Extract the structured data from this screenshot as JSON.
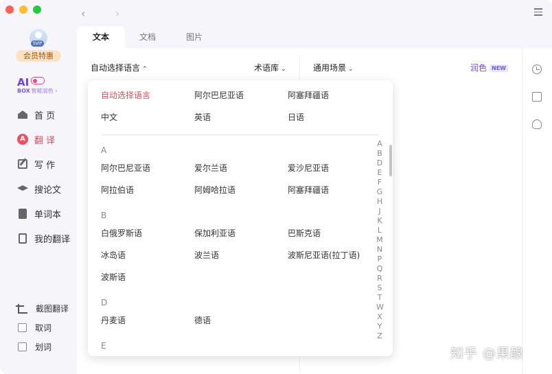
{
  "sidebar": {
    "avatar_badge": "SVIP",
    "member_label": "会员特惠",
    "aibox": {
      "ai": "AI",
      "box": "BOX",
      "sub": "智能润色 ›"
    },
    "nav": [
      {
        "label": "首 页",
        "icon": "home-icon"
      },
      {
        "label": "翻 译",
        "icon": "translate-icon",
        "active": true
      },
      {
        "label": "写 作",
        "icon": "write-icon"
      },
      {
        "label": "搜论文",
        "icon": "graduation-cap-icon"
      },
      {
        "label": "单词本",
        "icon": "bookmark-icon"
      },
      {
        "label": "我的翻译",
        "icon": "document-icon"
      }
    ],
    "bottom": {
      "screenshot_translate": "截图翻译",
      "pick_word": "取词",
      "select_word": "划词"
    }
  },
  "tabs": [
    "文本",
    "文档",
    "图片"
  ],
  "toolbar": {
    "source_lang": "自动选择语言",
    "termbase": "术语库",
    "scene": "通用场景",
    "polish": "润色",
    "polish_badge": "NEW"
  },
  "dropdown": {
    "top": [
      [
        "自动选择语言",
        "阿尔巴尼亚语",
        "阿塞拜疆语"
      ],
      [
        "中文",
        "英语",
        "日语"
      ]
    ],
    "sections": [
      {
        "letter": "A",
        "rows": [
          [
            "阿尔巴尼亚语",
            "爱尔兰语",
            "爱沙尼亚语"
          ],
          [
            "阿拉伯语",
            "阿姆哈拉语",
            "阿塞拜疆语"
          ]
        ]
      },
      {
        "letter": "B",
        "rows": [
          [
            "白俄罗斯语",
            "保加利亚语",
            "巴斯克语"
          ],
          [
            "冰岛语",
            "波兰语",
            "波斯尼亚语(拉丁语)"
          ],
          [
            "波斯语"
          ]
        ]
      },
      {
        "letter": "D",
        "rows": [
          [
            "丹麦语",
            "德语"
          ]
        ]
      },
      {
        "letter": "E",
        "rows": []
      }
    ],
    "alphabet": [
      "A",
      "B",
      "D",
      "E",
      "F",
      "G",
      "H",
      "J",
      "K",
      "L",
      "M",
      "N",
      "P",
      "Q",
      "R",
      "S",
      "T",
      "W",
      "X",
      "Y",
      "Z"
    ]
  },
  "watermark": "知乎 @果酿"
}
